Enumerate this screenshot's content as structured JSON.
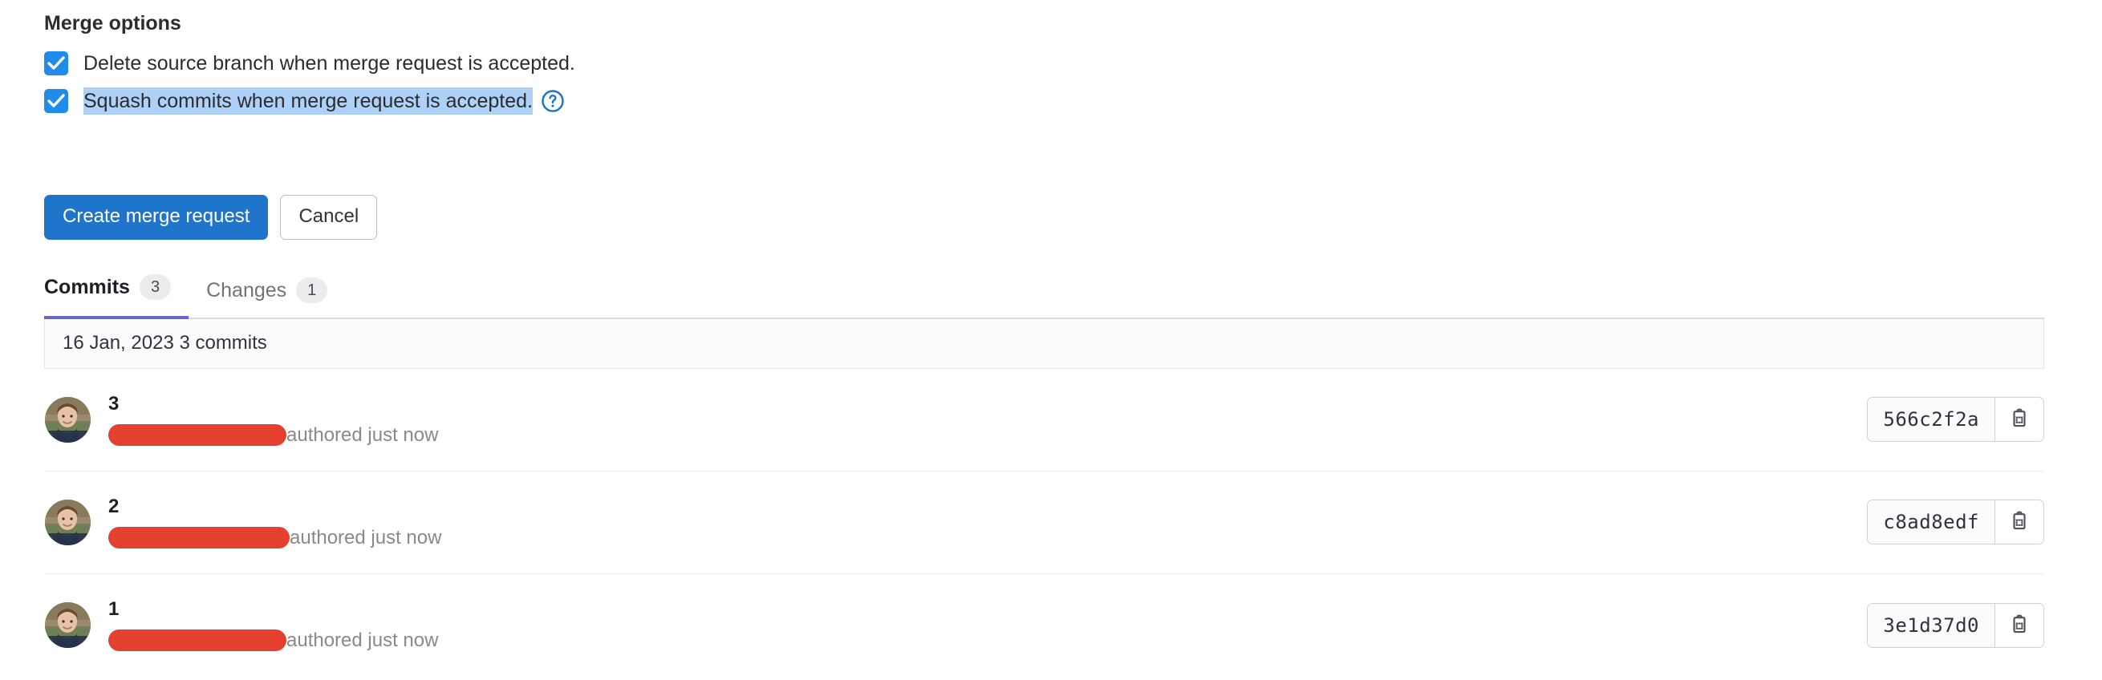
{
  "merge_options": {
    "heading": "Merge options",
    "checkboxes": [
      {
        "label": "Delete source branch when merge request is accepted.",
        "checked": true,
        "selected": false,
        "has_help_icon": false
      },
      {
        "label": "Squash commits when merge request is accepted.",
        "checked": true,
        "selected": true,
        "has_help_icon": true,
        "help_icon": "question-circle-icon"
      }
    ]
  },
  "actions": {
    "primary_label": "Create merge request",
    "secondary_label": "Cancel"
  },
  "tabs": [
    {
      "label": "Commits",
      "count": "3",
      "active": true
    },
    {
      "label": "Changes",
      "count": "1",
      "active": false
    }
  ],
  "commits_panel": {
    "date_header": "16 Jan, 2023 3 commits",
    "rows": [
      {
        "title": "3",
        "author_redacted": true,
        "redaction_width": 222,
        "meta": "authored just now",
        "sha": "566c2f2a",
        "copy_icon": "clipboard-copy-icon"
      },
      {
        "title": "2",
        "author_redacted": true,
        "redaction_width": 226,
        "meta": "authored just now",
        "sha": "c8ad8edf",
        "copy_icon": "clipboard-copy-icon"
      },
      {
        "title": "1",
        "author_redacted": true,
        "redaction_width": 222,
        "meta": "authored just now",
        "sha": "3e1d37d0",
        "copy_icon": "clipboard-copy-icon"
      }
    ]
  },
  "colors": {
    "primary_button": "#1f75cb",
    "checkbox": "#1f8ceb",
    "active_tab_underline": "#6666c4",
    "selection_highlight": "#aed2f7",
    "redaction": "#e4402f",
    "help_icon": "#1f75cb"
  }
}
